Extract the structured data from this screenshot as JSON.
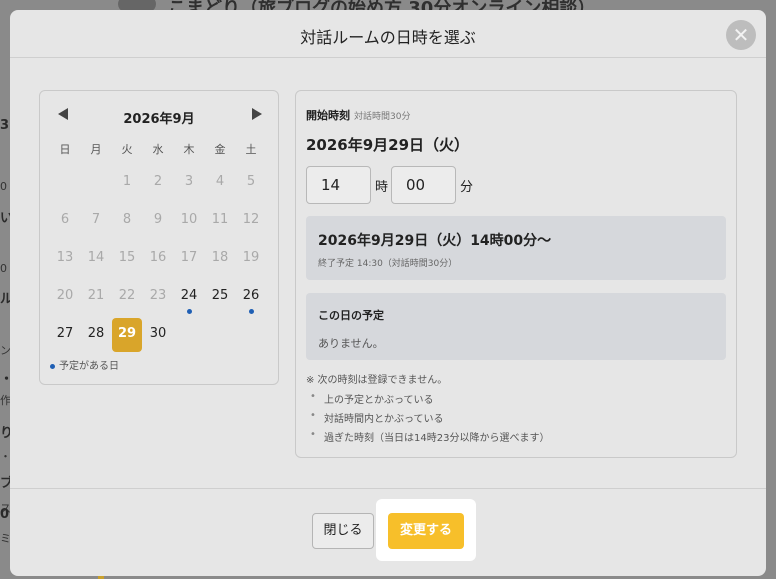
{
  "background": {
    "title_fragment": "こまどり（旅ブログの始め方 30分オンライン相談）",
    "left_fragments": [
      "3",
      "0",
      "い",
      "0",
      "ル",
      "ン",
      "・",
      "作",
      "り",
      "・",
      "ブ",
      "ス",
      "0",
      "ミ"
    ]
  },
  "modal": {
    "title": "対話ルームの日時を選ぶ",
    "close_symbol": "✕"
  },
  "calendar": {
    "month_label": "2026年9月",
    "prev_symbol": "◀",
    "next_symbol": "▶",
    "weekdays": [
      "日",
      "月",
      "火",
      "水",
      "木",
      "金",
      "土"
    ],
    "days": [
      {
        "d": "1",
        "col": 2,
        "row": 0,
        "state": "past"
      },
      {
        "d": "2",
        "col": 3,
        "row": 0,
        "state": "past"
      },
      {
        "d": "3",
        "col": 4,
        "row": 0,
        "state": "past"
      },
      {
        "d": "4",
        "col": 5,
        "row": 0,
        "state": "past"
      },
      {
        "d": "5",
        "col": 6,
        "row": 0,
        "state": "past"
      },
      {
        "d": "6",
        "col": 0,
        "row": 1,
        "state": "past"
      },
      {
        "d": "7",
        "col": 1,
        "row": 1,
        "state": "past"
      },
      {
        "d": "8",
        "col": 2,
        "row": 1,
        "state": "past"
      },
      {
        "d": "9",
        "col": 3,
        "row": 1,
        "state": "past"
      },
      {
        "d": "10",
        "col": 4,
        "row": 1,
        "state": "past"
      },
      {
        "d": "11",
        "col": 5,
        "row": 1,
        "state": "past"
      },
      {
        "d": "12",
        "col": 6,
        "row": 1,
        "state": "past"
      },
      {
        "d": "13",
        "col": 0,
        "row": 2,
        "state": "past"
      },
      {
        "d": "14",
        "col": 1,
        "row": 2,
        "state": "past"
      },
      {
        "d": "15",
        "col": 2,
        "row": 2,
        "state": "past"
      },
      {
        "d": "16",
        "col": 3,
        "row": 2,
        "state": "past"
      },
      {
        "d": "17",
        "col": 4,
        "row": 2,
        "state": "past"
      },
      {
        "d": "18",
        "col": 5,
        "row": 2,
        "state": "past"
      },
      {
        "d": "19",
        "col": 6,
        "row": 2,
        "state": "past"
      },
      {
        "d": "20",
        "col": 0,
        "row": 3,
        "state": "past"
      },
      {
        "d": "21",
        "col": 1,
        "row": 3,
        "state": "past"
      },
      {
        "d": "22",
        "col": 2,
        "row": 3,
        "state": "past"
      },
      {
        "d": "23",
        "col": 3,
        "row": 3,
        "state": "past"
      },
      {
        "d": "24",
        "col": 4,
        "row": 3,
        "state": "avail",
        "has_event": true
      },
      {
        "d": "25",
        "col": 5,
        "row": 3,
        "state": "avail"
      },
      {
        "d": "26",
        "col": 6,
        "row": 3,
        "state": "avail",
        "has_event": true
      },
      {
        "d": "27",
        "col": 0,
        "row": 4,
        "state": "avail"
      },
      {
        "d": "28",
        "col": 1,
        "row": 4,
        "state": "avail"
      },
      {
        "d": "29",
        "col": 2,
        "row": 4,
        "state": "selected"
      },
      {
        "d": "30",
        "col": 3,
        "row": 4,
        "state": "avail"
      }
    ],
    "legend": "予定がある日"
  },
  "selection": {
    "start_label": "開始時刻",
    "start_sub": "対話時間30分",
    "date_heading": "2026年9月29日（火）",
    "hour_value": "14",
    "hour_unit": "時",
    "minute_value": "00",
    "minute_unit": "分",
    "summary_main": "2026年9月29日（火）14時00分〜",
    "summary_sub": "終了予定 14:30（対話時間30分）",
    "schedule_title": "この日の予定",
    "schedule_empty": "ありません。",
    "notes_head": "※ 次の時刻は登録できません。",
    "notes": [
      "上の予定とかぶっている",
      "対話時間内とかぶっている",
      "過ぎた時刻（当日は14時23分以降から選べます）"
    ]
  },
  "footer": {
    "close_label": "閉じる",
    "change_label": "変更する"
  },
  "colors": {
    "accent": "#f7bf2a",
    "selected_day": "#d9a52a",
    "event_dot": "#1f5fb4"
  }
}
